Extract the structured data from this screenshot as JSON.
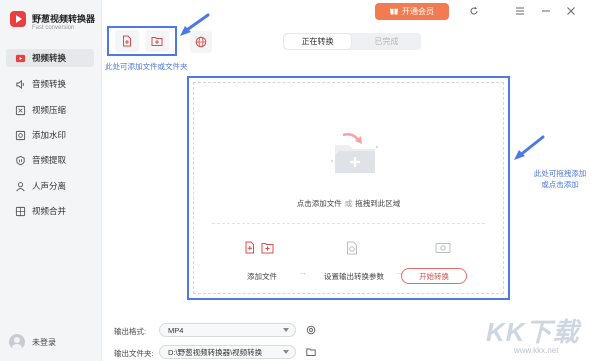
{
  "app": {
    "title": "野葱视频转换器",
    "subtitle": "Fast conversion"
  },
  "sidebar": {
    "items": [
      {
        "label": "视频转换",
        "icon": "video-convert-icon",
        "active": true
      },
      {
        "label": "音频转换",
        "icon": "audio-convert-icon",
        "active": false
      },
      {
        "label": "视频压缩",
        "icon": "compress-icon",
        "active": false
      },
      {
        "label": "添加水印",
        "icon": "watermark-icon",
        "active": false
      },
      {
        "label": "音频提取",
        "icon": "audio-extract-icon",
        "active": false
      },
      {
        "label": "人声分离",
        "icon": "voice-separation-icon",
        "active": false
      },
      {
        "label": "视频合并",
        "icon": "merge-icon",
        "active": false
      }
    ],
    "login_label": "未登录"
  },
  "header": {
    "vip_label": "开通会员",
    "icons": [
      "refresh-icon",
      "menu-icon",
      "minimize-icon",
      "close-icon"
    ]
  },
  "toolbar": {
    "add_file_icon": "add-file-icon",
    "add_folder_icon": "add-folder-icon",
    "url_icon": "globe-icon",
    "hint": "此处可添加文件或文件夹"
  },
  "tabs": [
    {
      "label": "正在转换",
      "active": true
    },
    {
      "label": "已完成",
      "active": false
    }
  ],
  "dropzone": {
    "click_text": "点击添加文件",
    "or_text": "或",
    "drag_text": "拖拽到此区域",
    "steps": [
      {
        "label": "添加文件"
      },
      {
        "label": "设置输出转换参数"
      }
    ],
    "start_label": "开始转换",
    "side_hint_line1": "此处可拖拽添加",
    "side_hint_line2": "或点击添加"
  },
  "output": {
    "format_label": "输出格式:",
    "format_value": "MP4",
    "folder_label": "输出文件夹:",
    "folder_value": "D:\\野葱视频转换器\\视频转换"
  },
  "watermark": {
    "text": "KK下载",
    "url": "www.kkx.net"
  },
  "colors": {
    "accent": "#f37b52",
    "annotation_blue": "#4d79e6",
    "logo_red": "#ea3f3f",
    "sidebar_bg": "#f4f5f7"
  }
}
